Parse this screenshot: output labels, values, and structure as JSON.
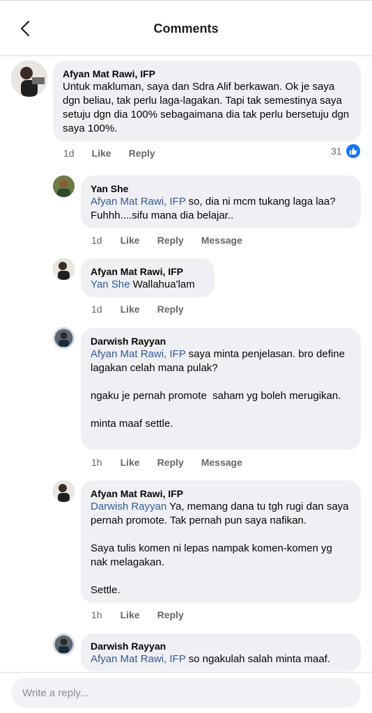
{
  "header": {
    "title": "Comments"
  },
  "comments": [
    {
      "author": "Afyan Mat Rawi, IFP",
      "mention": "",
      "text": "Untuk makluman, saya dan Sdra Alif berkawan. Ok je saya dgn beliau, tak perlu laga-lagakan. Tapi tak semestinya saya setuju dgn dia 100% sebagaimana dia tak perlu bersetuju dgn saya 100%.",
      "time": "1d",
      "like": "Like",
      "reply": "Reply",
      "likes_count": "31"
    },
    {
      "author": "Yan She",
      "mention": "Afyan Mat Rawi, IFP",
      "text": " so, dia ni mcm tukang laga laa? Fuhhh....sifu mana dia belajar..",
      "time": "1d",
      "like": "Like",
      "reply": "Reply",
      "message": "Message"
    },
    {
      "author": "Afyan Mat Rawi, IFP",
      "mention": "Yan She",
      "text": " Wallahua'lam",
      "time": "1d",
      "like": "Like",
      "reply": "Reply"
    },
    {
      "author": "Darwish Rayyan",
      "mention": "Afyan Mat Rawi, IFP",
      "text": " saya minta penjelasan. bro define lagakan celah mana pulak?\n\nngaku je pernah promote  saham yg boleh merugikan.\n\nminta maaf settle.",
      "time": "1h",
      "like": "Like",
      "reply": "Reply",
      "message": "Message"
    },
    {
      "author": "Afyan Mat Rawi, IFP",
      "mention": "Darwish Rayyan",
      "text": " Ya, memang dana tu tgh rugi dan saya pernah promote. Tak pernah pun saya nafikan.\n\nSaya tulis komen ni lepas nampak komen-komen yg nak melagakan.\n\nSettle.",
      "time": "1h",
      "like": "Like",
      "reply": "Reply"
    },
    {
      "author": "Darwish Rayyan",
      "mention": "Afyan Mat Rawi, IFP",
      "text": " so ngakulah salah minta maaf.",
      "time": "",
      "like": "",
      "reply": ""
    }
  ],
  "reply_box": {
    "placeholder": "Write a reply..."
  },
  "colors": {
    "mention": "#385898",
    "bubble": "#eff0f3",
    "like_badge": "#1877f2"
  },
  "icons": {
    "back": "chevron-left-icon",
    "like_reaction": "thumbs-up-icon"
  }
}
